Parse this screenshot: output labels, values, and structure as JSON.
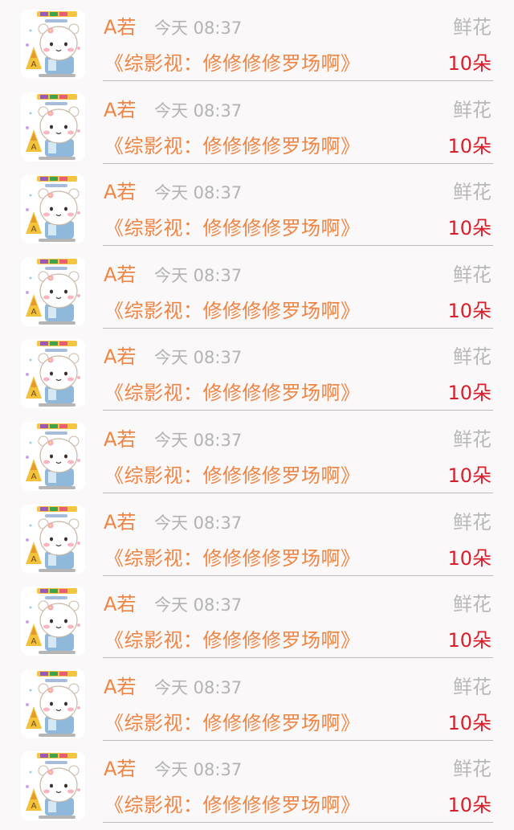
{
  "items": [
    {
      "name": "A若",
      "time": "今天 08:37",
      "gift_label": "鲜花",
      "title": "《综影视：修修修修罗场啊》",
      "count": "10朵"
    },
    {
      "name": "A若",
      "time": "今天 08:37",
      "gift_label": "鲜花",
      "title": "《综影视：修修修修罗场啊》",
      "count": "10朵"
    },
    {
      "name": "A若",
      "time": "今天 08:37",
      "gift_label": "鲜花",
      "title": "《综影视：修修修修罗场啊》",
      "count": "10朵"
    },
    {
      "name": "A若",
      "time": "今天 08:37",
      "gift_label": "鲜花",
      "title": "《综影视：修修修修罗场啊》",
      "count": "10朵"
    },
    {
      "name": "A若",
      "time": "今天 08:37",
      "gift_label": "鲜花",
      "title": "《综影视：修修修修罗场啊》",
      "count": "10朵"
    },
    {
      "name": "A若",
      "time": "今天 08:37",
      "gift_label": "鲜花",
      "title": "《综影视：修修修修罗场啊》",
      "count": "10朵"
    },
    {
      "name": "A若",
      "time": "今天 08:37",
      "gift_label": "鲜花",
      "title": "《综影视：修修修修罗场啊》",
      "count": "10朵"
    },
    {
      "name": "A若",
      "time": "今天 08:37",
      "gift_label": "鲜花",
      "title": "《综影视：修修修修罗场啊》",
      "count": "10朵"
    },
    {
      "name": "A若",
      "time": "今天 08:37",
      "gift_label": "鲜花",
      "title": "《综影视：修修修修罗场啊》",
      "count": "10朵"
    },
    {
      "name": "A若",
      "time": "今天 08:37",
      "gift_label": "鲜花",
      "title": "《综影视：修修修修罗场啊》",
      "count": "10朵"
    }
  ],
  "colors": {
    "name": "#ee8545",
    "title": "#ee8545",
    "time": "#b3b3b3",
    "gift_label": "#b8b8b8",
    "count": "#d71f2c",
    "background": "#fbf8f9"
  },
  "avatar_icon": "cartoon-bear-avatar"
}
